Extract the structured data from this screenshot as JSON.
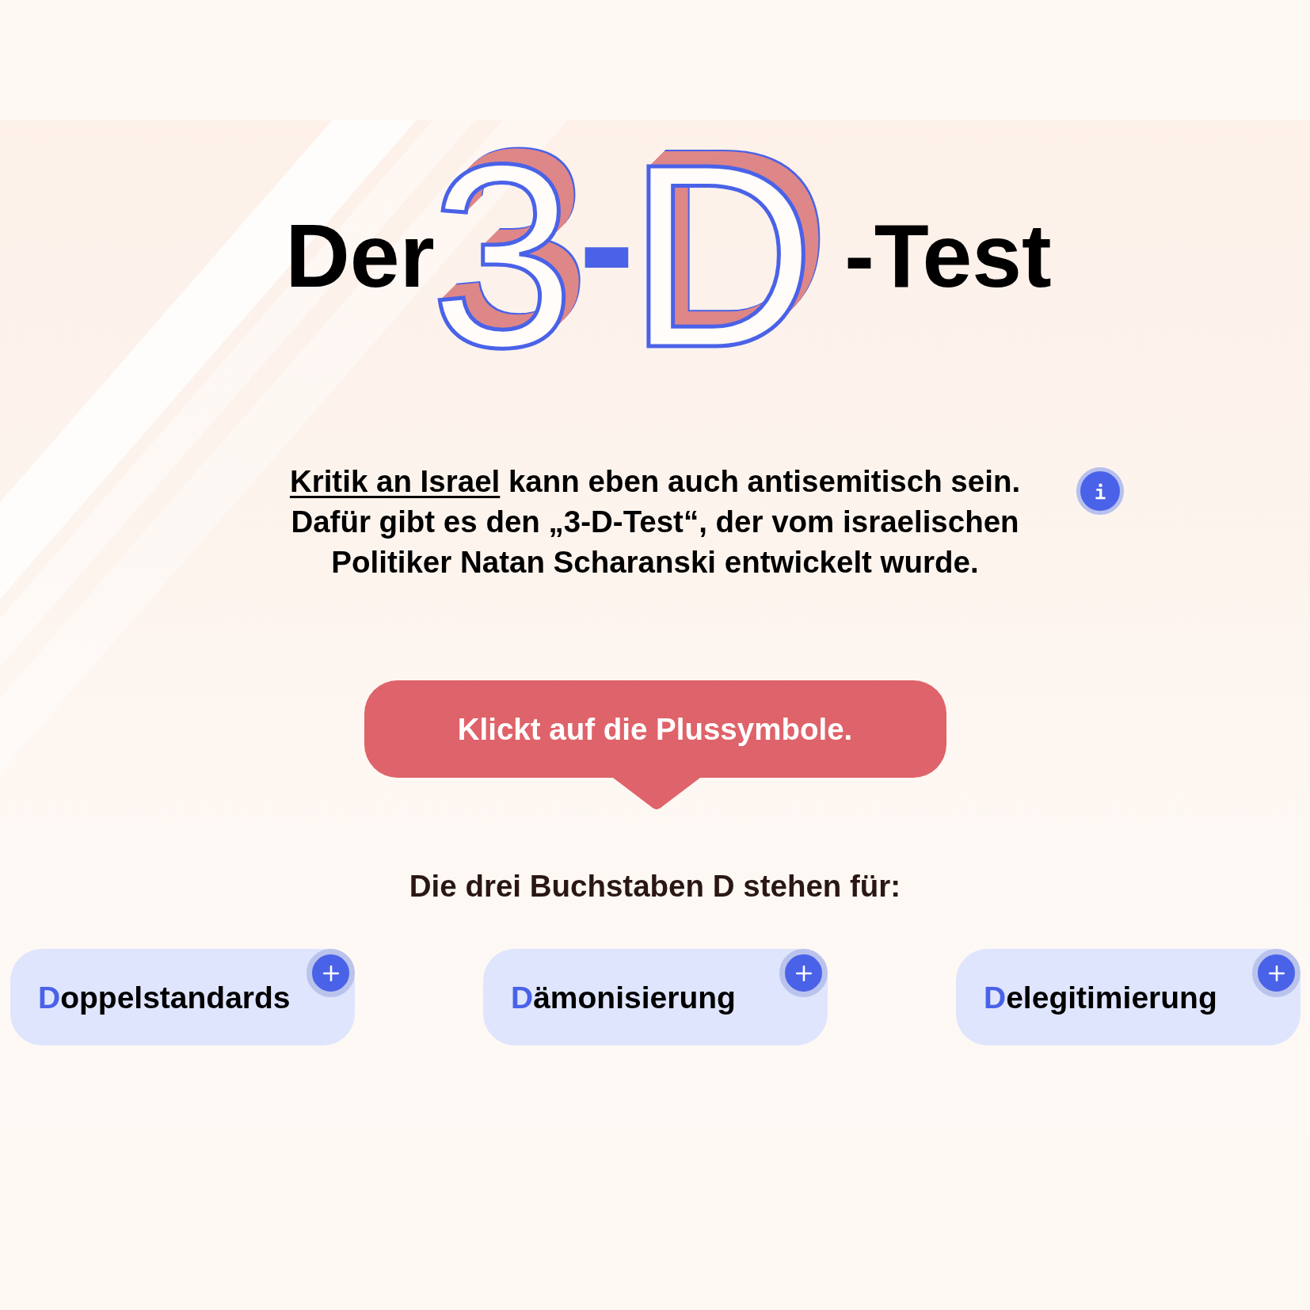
{
  "title": {
    "parts": [
      {
        "text": "Der",
        "kind": "plain"
      },
      {
        "text": "3",
        "kind": "outlined"
      },
      {
        "text": "-",
        "kind": "solid"
      },
      {
        "text": "D",
        "kind": "outlined"
      },
      {
        "text": "-Test",
        "kind": "plain"
      }
    ]
  },
  "intro": {
    "link": "Kritik an Israel",
    "first_line_rest": "kann eben auch antisemitisch sein.",
    "more_lines": [
      "Dafür gibt es den „3-D-Test“, der vom israelischen",
      "Politiker Natan Scharanski entwickelt wurde."
    ]
  },
  "instruction": "Klickt auf die Plussymbole.",
  "cards_heading": "Die drei Buchstaben D stehen für:",
  "cards": [
    {
      "label": "Doppelstandards"
    },
    {
      "label": "Dämonisierung"
    },
    {
      "label": "Delegitimierung"
    }
  ]
}
